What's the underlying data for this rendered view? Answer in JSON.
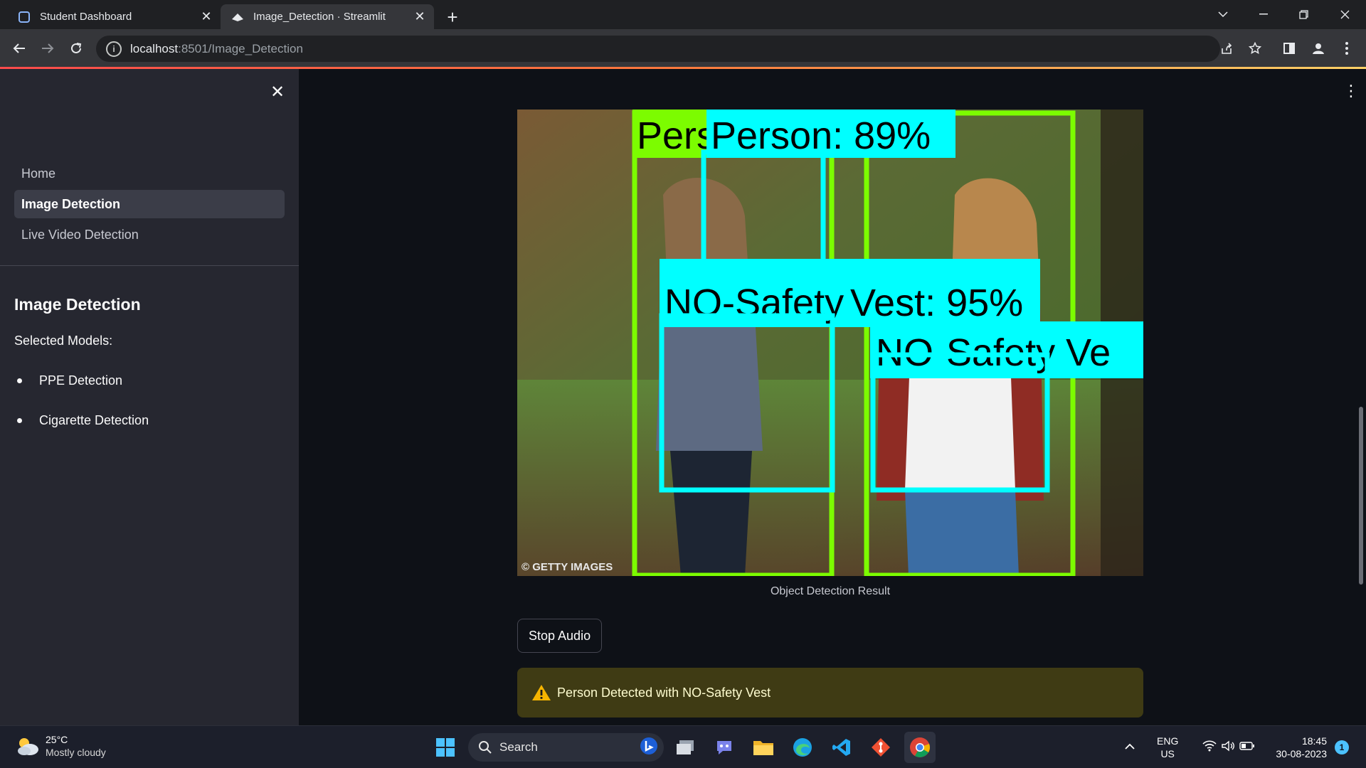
{
  "browser": {
    "tabs": [
      {
        "title": "Student Dashboard",
        "active": false
      },
      {
        "title": "Image_Detection · Streamlit",
        "active": true
      }
    ],
    "url_host": "localhost",
    "url_rest": ":8501/Image_Detection"
  },
  "sidebar": {
    "nav": [
      {
        "label": "Home",
        "active": false
      },
      {
        "label": "Image Detection",
        "active": true
      },
      {
        "label": "Live Video Detection",
        "active": false
      }
    ],
    "section_title": "Image Detection",
    "selected_models_label": "Selected Models:",
    "models": [
      "PPE Detection",
      "Cigarette Detection"
    ]
  },
  "main": {
    "image": {
      "labels": {
        "person_left_partial": "Pers",
        "person_right": "Person: 89%",
        "vest_left": "NO-Safety",
        "vest_top_right": "Vest: 95%",
        "vest_right": "NO-Safety Ve"
      },
      "watermark": "© GETTY IMAGES"
    },
    "caption": "Object Detection Result",
    "stop_audio_label": "Stop Audio",
    "alert_message": "Person Detected with NO-Safety Vest",
    "colors": {
      "person_box": "#7cfc00",
      "vest_box": "#00ffff",
      "alert_bg": "#3f3b14",
      "alert_text": "#fffdd0"
    }
  },
  "taskbar": {
    "weather_temp": "25°C",
    "weather_desc": "Mostly cloudy",
    "search_label": "Search",
    "lang_top": "ENG",
    "lang_bottom": "US",
    "time": "18:45",
    "date": "30-08-2023",
    "notification_count": "1",
    "pinned_apps": [
      "windows-start",
      "search",
      "bing",
      "file-explorer-snap",
      "teams",
      "file-explorer",
      "edge",
      "vscode",
      "git",
      "chrome"
    ]
  }
}
